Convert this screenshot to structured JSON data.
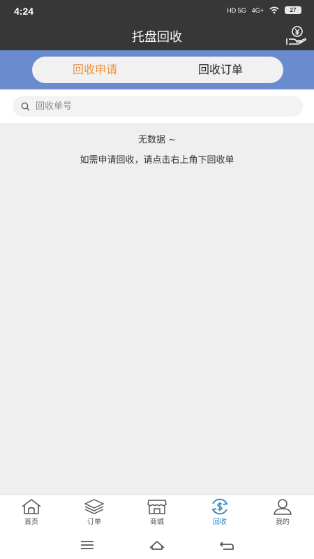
{
  "status_bar": {
    "time": "4:24",
    "network_1": "HD 5G",
    "network_2": "4G+",
    "battery": "27"
  },
  "header": {
    "title": "托盘回收",
    "action_icon": "recycle-hand-yen-icon"
  },
  "tabs": [
    {
      "label": "回收申请",
      "active": true
    },
    {
      "label": "回收订单",
      "active": false
    }
  ],
  "search": {
    "placeholder": "回收单号",
    "value": ""
  },
  "empty_state": {
    "line1": "无数据 ~",
    "line2": "如需申请回收，请点击右上角下回收单"
  },
  "bottom_nav": [
    {
      "label": "首页",
      "icon": "home-icon",
      "active": false
    },
    {
      "label": "订单",
      "icon": "layers-icon",
      "active": false
    },
    {
      "label": "商城",
      "icon": "store-icon",
      "active": false
    },
    {
      "label": "回收",
      "icon": "recycle-dollar-icon",
      "active": true
    },
    {
      "label": "我的",
      "icon": "user-icon",
      "active": false
    }
  ],
  "colors": {
    "header_bg": "#373737",
    "tab_bar_bg": "#6a8ccf",
    "active_tab": "#f0923a",
    "active_nav": "#2a88c4"
  }
}
